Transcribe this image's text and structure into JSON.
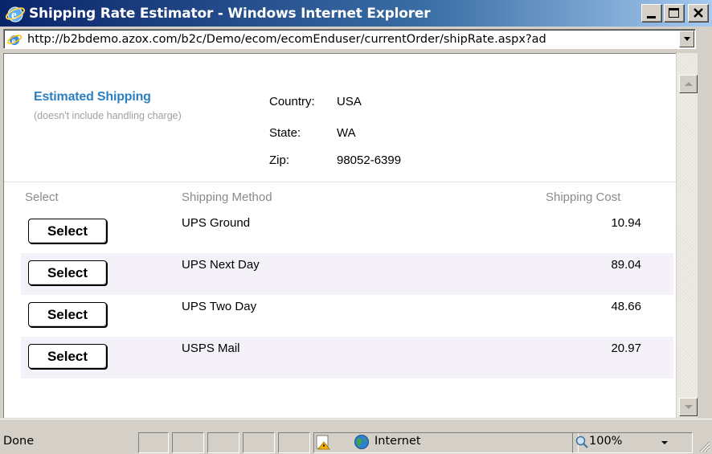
{
  "window": {
    "title": "Shipping Rate Estimator - Windows Internet Explorer",
    "title_bar_color": "#0a246a"
  },
  "address_bar": {
    "url": "http://b2bdemo.azox.com/b2c/Demo/ecom/ecomEnduser/currentOrder/shipRate.aspx?ad"
  },
  "estimate": {
    "heading": "Estimated Shipping",
    "subheading": "(doesn't include handling charge)",
    "heading_color": "#2b7fc1",
    "country_label": "Country:",
    "country_value": "USA",
    "state_label": "State:",
    "state_value": "WA",
    "zip_label": "Zip:",
    "zip_value": "98052-6399"
  },
  "table": {
    "headers": [
      "Select",
      "Shipping Method",
      "Shipping Cost"
    ],
    "rows": [
      {
        "button": "Select",
        "method": "UPS Ground",
        "cost": "10.94"
      },
      {
        "button": "Select",
        "method": "UPS Next Day",
        "cost": "89.04"
      },
      {
        "button": "Select",
        "method": "UPS Two Day",
        "cost": "48.66"
      },
      {
        "button": "Select",
        "method": "USPS Mail",
        "cost": "20.97"
      }
    ]
  },
  "status_bar": {
    "status": "Done",
    "zone": "Internet",
    "zoom": "100%"
  },
  "icons": [
    "ie-logo-icon",
    "minimize-icon",
    "maximize-icon",
    "close-icon",
    "page-ie-icon",
    "dropdown-arrow-icon",
    "scroll-up-icon",
    "scroll-down-icon",
    "security-warning-icon",
    "globe-icon",
    "zoom-icon",
    "resize-grip-icon"
  ]
}
